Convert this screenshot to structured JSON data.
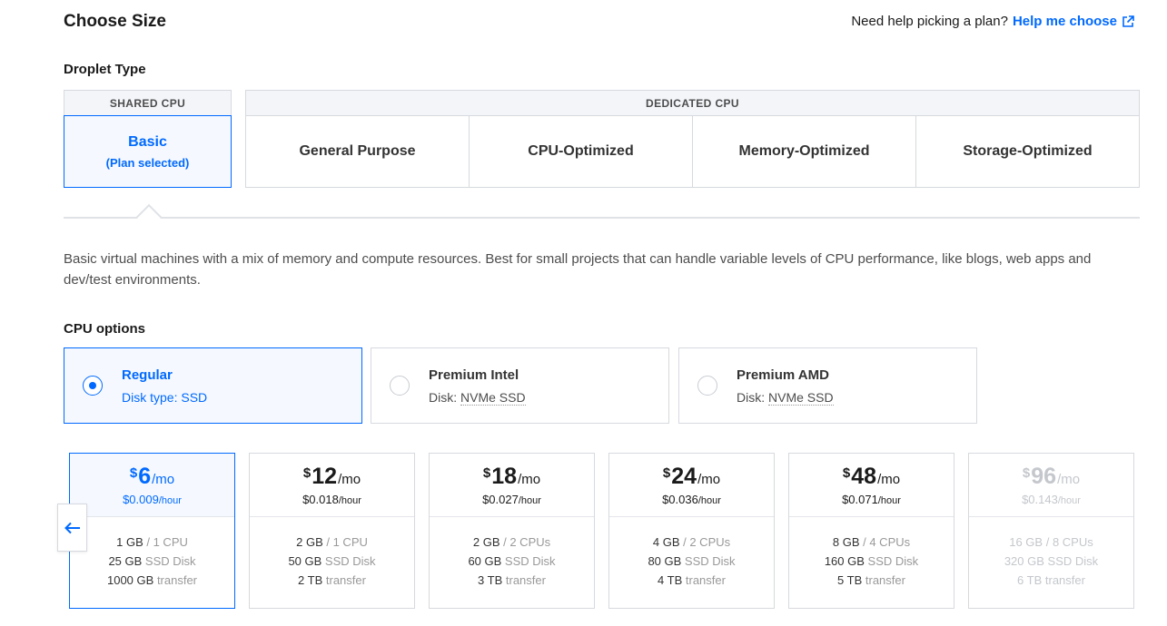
{
  "header": {
    "title": "Choose Size",
    "help_question": "Need help picking a plan?",
    "help_link": "Help me choose",
    "help_link_icon": "external-link-icon"
  },
  "droplet_type": {
    "label": "Droplet Type",
    "shared": {
      "group_label": "SHARED CPU",
      "option": {
        "name": "Basic",
        "status": "(Plan selected)"
      }
    },
    "dedicated": {
      "group_label": "DEDICATED CPU",
      "options": [
        "General Purpose",
        "CPU-Optimized",
        "Memory-Optimized",
        "Storage-Optimized"
      ]
    }
  },
  "description": "Basic virtual machines with a mix of memory and compute resources. Best for small projects that can handle variable levels of CPU performance, like blogs, web apps and dev/test environments.",
  "cpu_options": {
    "label": "CPU options",
    "options": [
      {
        "name": "Regular",
        "disk_label": "Disk type: ",
        "disk": "SSD",
        "selected": true
      },
      {
        "name": "Premium Intel",
        "disk_label": "Disk: ",
        "disk": "NVMe SSD",
        "selected": false
      },
      {
        "name": "Premium AMD",
        "disk_label": "Disk: ",
        "disk": "NVMe SSD",
        "selected": false
      }
    ]
  },
  "plans": {
    "currency": "$",
    "per_month": "/mo",
    "per_hour": "/hour",
    "scroll_left_icon": "arrow-left-icon",
    "items": [
      {
        "monthly": "6",
        "hourly": "$0.009",
        "memory": "1 GB",
        "cpus": "1 CPU",
        "disk": "25 GB",
        "disk_type": "SSD Disk",
        "transfer": "1000 GB",
        "transfer_label": "transfer",
        "state": "selected"
      },
      {
        "monthly": "12",
        "hourly": "$0.018",
        "memory": "2 GB",
        "cpus": "1 CPU",
        "disk": "50 GB",
        "disk_type": "SSD Disk",
        "transfer": "2 TB",
        "transfer_label": "transfer",
        "state": "normal"
      },
      {
        "monthly": "18",
        "hourly": "$0.027",
        "memory": "2 GB",
        "cpus": "2 CPUs",
        "disk": "60 GB",
        "disk_type": "SSD Disk",
        "transfer": "3 TB",
        "transfer_label": "transfer",
        "state": "normal"
      },
      {
        "monthly": "24",
        "hourly": "$0.036",
        "memory": "4 GB",
        "cpus": "2 CPUs",
        "disk": "80 GB",
        "disk_type": "SSD Disk",
        "transfer": "4 TB",
        "transfer_label": "transfer",
        "state": "normal"
      },
      {
        "monthly": "48",
        "hourly": "$0.071",
        "memory": "8 GB",
        "cpus": "4 CPUs",
        "disk": "160 GB",
        "disk_type": "SSD Disk",
        "transfer": "5 TB",
        "transfer_label": "transfer",
        "state": "normal"
      },
      {
        "monthly": "96",
        "hourly": "$0.143",
        "memory": "16 GB",
        "cpus": "8 CPUs",
        "disk": "320 GB",
        "disk_type": "SSD Disk",
        "transfer": "6 TB",
        "transfer_label": "transfer",
        "state": "disabled"
      }
    ]
  },
  "colors": {
    "accent": "#0069ff",
    "border": "#d6d9de",
    "selected_bg": "#f5f9ff"
  }
}
